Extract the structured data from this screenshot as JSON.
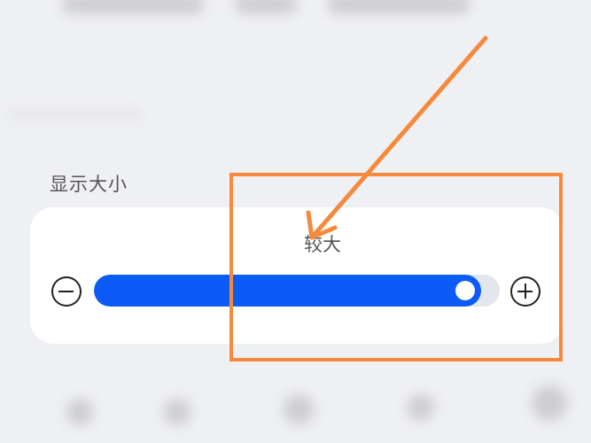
{
  "display_size": {
    "section_title": "显示大小",
    "current_size_label": "较大",
    "level": 0.95,
    "decrease_icon": "minus-circle-icon",
    "increase_icon": "plus-circle-icon"
  },
  "annotation": {
    "color": "#f68a3c",
    "type": "box-with-arrow"
  },
  "colors": {
    "accent": "#0c5bf6",
    "background": "#eff0f4",
    "card": "#ffffff"
  }
}
